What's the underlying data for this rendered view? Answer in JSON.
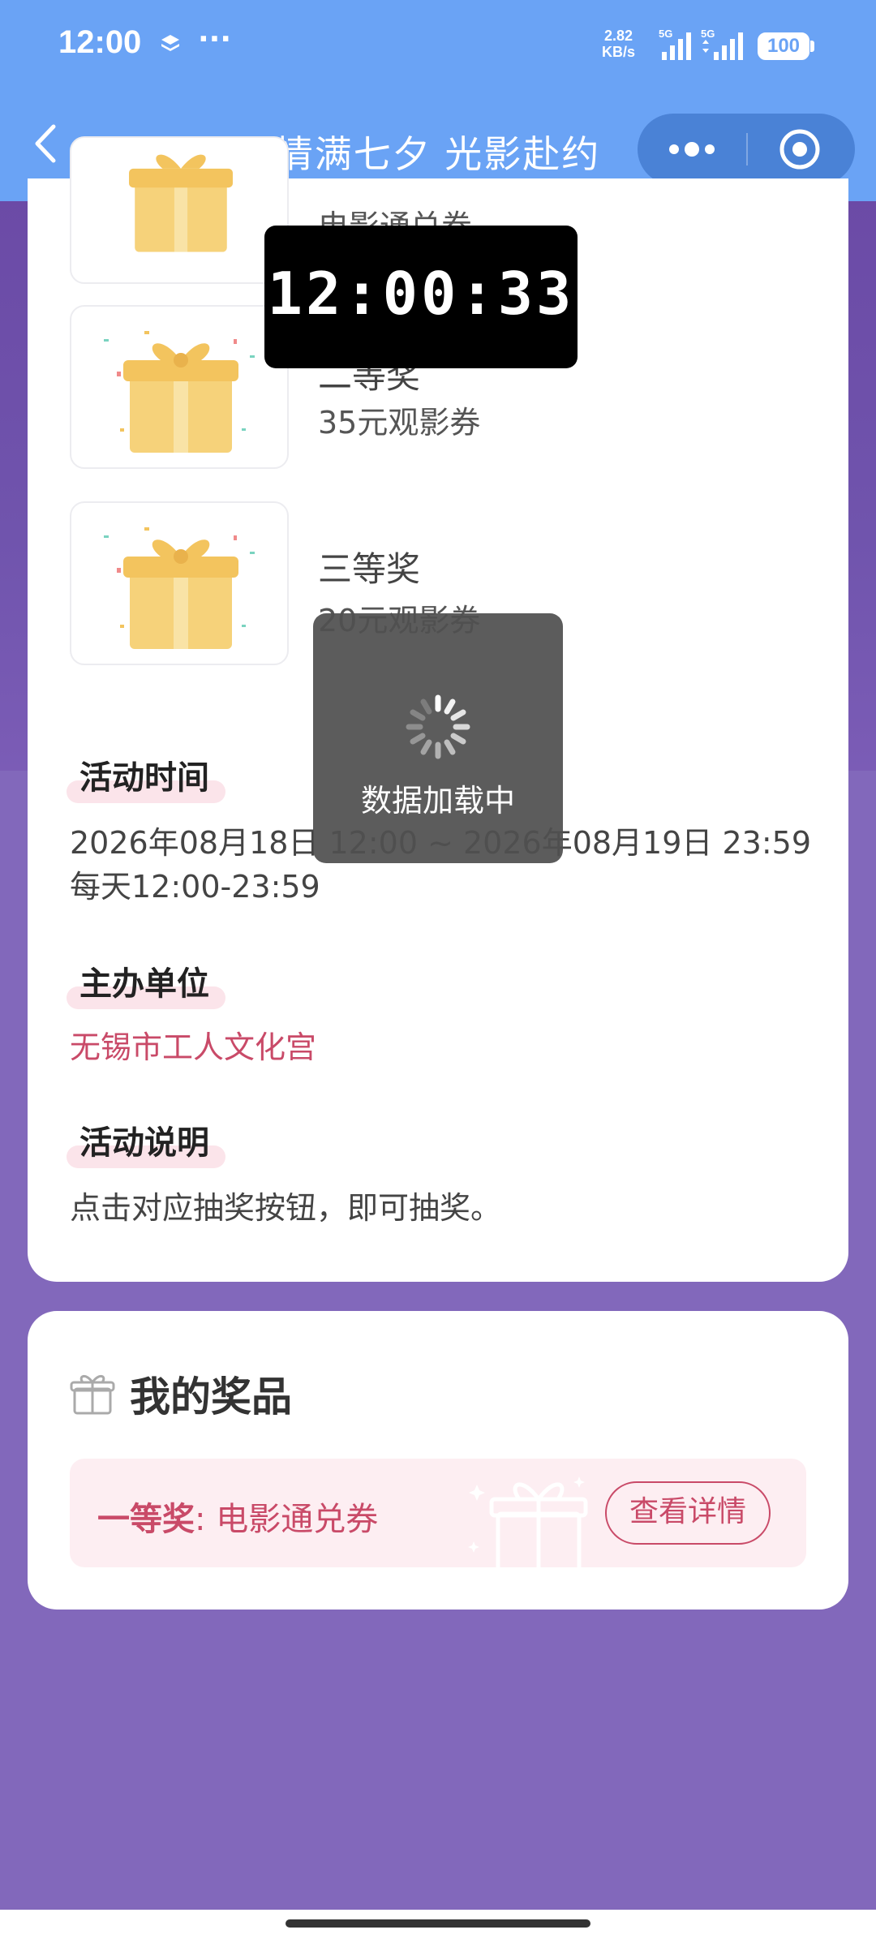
{
  "status_bar": {
    "time": "12:00",
    "dots": "···",
    "speed_value": "2.82",
    "speed_unit": "KB/s",
    "network_1": "5G",
    "network_2": "5G",
    "battery": "100"
  },
  "title_bar": {
    "title": "情满七夕 光影赴约"
  },
  "prizes_list": [
    {
      "name": "",
      "desc": "电影通兑券"
    },
    {
      "name": "二等奖",
      "desc": "35元观影券"
    },
    {
      "name": "三等奖",
      "desc": "20元观影券"
    }
  ],
  "sections": {
    "time_title": "活动时间",
    "time_range": "2026年08月18日 12:00 ~ 2026年08月19日 23:59",
    "time_daily": "每天12:00-23:59",
    "organizer_title": "主办单位",
    "organizer": "无锡市工人文化宫",
    "desc_title": "活动说明",
    "desc": "点击对应抽奖按钮，即可抽奖。"
  },
  "my_prizes": {
    "title": "我的奖品",
    "item_level": "一等奖",
    "item_colon": ":",
    "item_name": "电影通兑券",
    "detail_button": "查看详情"
  },
  "overlays": {
    "clock": "12:00:33",
    "loading_text": "数据加载中"
  },
  "colors": {
    "header_blue": "#6aa3f5",
    "accent_red": "#c94a68",
    "bg_purple": "#8268bb"
  }
}
